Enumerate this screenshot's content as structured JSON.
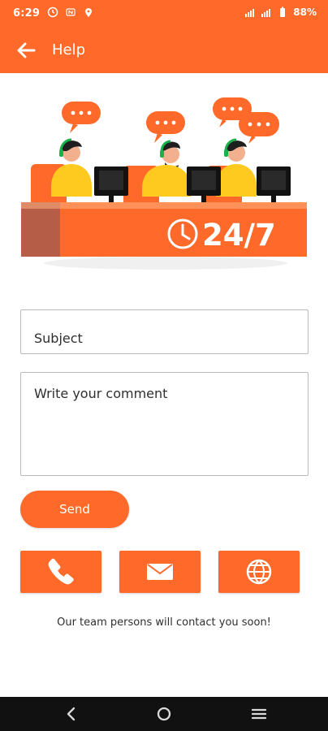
{
  "status_bar": {
    "time": "6:29",
    "battery": "88%",
    "icons": [
      "clock-icon",
      "nfc-icon",
      "location-icon",
      "signal-icon",
      "battery-icon"
    ]
  },
  "app_bar": {
    "title": "Help",
    "back_icon": "arrow-left-icon"
  },
  "illustration": {
    "support_label": "24/7"
  },
  "form": {
    "subject_placeholder": "Subject",
    "comment_placeholder": "Write your comment",
    "send_label": "Send"
  },
  "contact_actions": [
    {
      "icon": "phone-icon"
    },
    {
      "icon": "email-icon"
    },
    {
      "icon": "globe-icon"
    }
  ],
  "footer_note": "Our team persons will contact you soon!",
  "navigation": {
    "icons": [
      "back-nav-icon",
      "home-nav-icon",
      "menu-nav-icon"
    ]
  },
  "colors": {
    "primary": "#ff6a2b",
    "text": "#2f2f2f",
    "field_border": "#b9b9b9"
  }
}
